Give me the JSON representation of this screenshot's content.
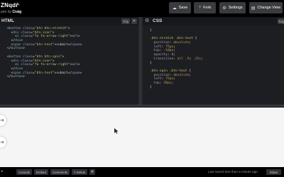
{
  "header": {
    "title": "ZNqdr",
    "author_prefix": "pen by",
    "author_name": "Craig",
    "buttons": {
      "save": "Save",
      "fork": "Fork",
      "settings": "Settings",
      "change_view": "Change View"
    }
  },
  "html_pane": {
    "title": "HTML",
    "tidy": "Tidy",
    "close": "✕",
    "lines": [
      [
        {
          "c": "t-punc",
          "t": "<"
        },
        {
          "c": "t-tag",
          "t": "button"
        },
        {
          "c": "t-txt",
          "t": " "
        },
        {
          "c": "t-attr",
          "t": "class"
        },
        {
          "c": "t-punc",
          "t": "="
        },
        {
          "c": "t-str",
          "t": "\"btn btn-stretch\""
        },
        {
          "c": "t-punc",
          "t": ">"
        }
      ],
      [
        {
          "c": "t-txt",
          "t": "  "
        },
        {
          "c": "t-punc",
          "t": "<"
        },
        {
          "c": "t-tag",
          "t": "div"
        },
        {
          "c": "t-txt",
          "t": " "
        },
        {
          "c": "t-attr",
          "t": "class"
        },
        {
          "c": "t-punc",
          "t": "="
        },
        {
          "c": "t-str",
          "t": "\"btn-icon\""
        },
        {
          "c": "t-punc",
          "t": ">"
        }
      ],
      [
        {
          "c": "t-txt",
          "t": "    "
        },
        {
          "c": "t-punc",
          "t": "<"
        },
        {
          "c": "t-tag",
          "t": "i"
        },
        {
          "c": "t-txt",
          "t": " "
        },
        {
          "c": "t-attr",
          "t": "class"
        },
        {
          "c": "t-punc",
          "t": "="
        },
        {
          "c": "t-str",
          "t": "\"fa fa-arrow-right\""
        },
        {
          "c": "t-punc",
          "t": "></"
        },
        {
          "c": "t-tag",
          "t": "i"
        },
        {
          "c": "t-punc",
          "t": ">"
        }
      ],
      [
        {
          "c": "t-txt",
          "t": "  "
        },
        {
          "c": "t-punc",
          "t": "</"
        },
        {
          "c": "t-tag",
          "t": "div"
        },
        {
          "c": "t-punc",
          "t": ">"
        }
      ],
      [
        {
          "c": "t-txt",
          "t": "  "
        },
        {
          "c": "t-punc",
          "t": "<"
        },
        {
          "c": "t-tag",
          "t": "span"
        },
        {
          "c": "t-txt",
          "t": " "
        },
        {
          "c": "t-attr",
          "t": "class"
        },
        {
          "c": "t-punc",
          "t": "="
        },
        {
          "c": "t-str",
          "t": "\"btn-text\""
        },
        {
          "c": "t-punc",
          "t": ">"
        },
        {
          "c": "t-txt",
          "t": "submit"
        },
        {
          "c": "t-punc",
          "t": "</"
        },
        {
          "c": "t-tag",
          "t": "span"
        },
        {
          "c": "t-punc",
          "t": ">"
        }
      ],
      [
        {
          "c": "t-punc",
          "t": "</"
        },
        {
          "c": "t-tag",
          "t": "button"
        },
        {
          "c": "t-punc",
          "t": ">"
        }
      ],
      [],
      [
        {
          "c": "t-punc",
          "t": "<"
        },
        {
          "c": "t-tag",
          "t": "button"
        },
        {
          "c": "t-txt",
          "t": " "
        },
        {
          "c": "t-attr",
          "t": "class"
        },
        {
          "c": "t-punc",
          "t": "="
        },
        {
          "c": "t-str",
          "t": "\"btn btn-spin\""
        },
        {
          "c": "t-punc",
          "t": ">"
        }
      ],
      [
        {
          "c": "t-txt",
          "t": "  "
        },
        {
          "c": "t-punc",
          "t": "<"
        },
        {
          "c": "t-tag",
          "t": "div"
        },
        {
          "c": "t-txt",
          "t": " "
        },
        {
          "c": "t-attr",
          "t": "class"
        },
        {
          "c": "t-punc",
          "t": "="
        },
        {
          "c": "t-str",
          "t": "\"btn-icon\""
        },
        {
          "c": "t-punc",
          "t": ">"
        }
      ],
      [
        {
          "c": "t-txt",
          "t": "    "
        },
        {
          "c": "t-punc",
          "t": "<"
        },
        {
          "c": "t-tag",
          "t": "i"
        },
        {
          "c": "t-txt",
          "t": " "
        },
        {
          "c": "t-attr",
          "t": "class"
        },
        {
          "c": "t-punc",
          "t": "="
        },
        {
          "c": "t-str",
          "t": "\"fa fa-arrow-right\""
        },
        {
          "c": "t-punc",
          "t": "></"
        },
        {
          "c": "t-tag",
          "t": "i"
        },
        {
          "c": "t-punc",
          "t": ">"
        }
      ],
      [
        {
          "c": "t-txt",
          "t": "  "
        },
        {
          "c": "t-punc",
          "t": "</"
        },
        {
          "c": "t-tag",
          "t": "div"
        },
        {
          "c": "t-punc",
          "t": ">"
        }
      ],
      [
        {
          "c": "t-txt",
          "t": "  "
        },
        {
          "c": "t-punc",
          "t": "<"
        },
        {
          "c": "t-tag",
          "t": "span"
        },
        {
          "c": "t-txt",
          "t": " "
        },
        {
          "c": "t-attr",
          "t": "class"
        },
        {
          "c": "t-punc",
          "t": "="
        },
        {
          "c": "t-str",
          "t": "\"btn-text\""
        },
        {
          "c": "t-punc",
          "t": ">"
        },
        {
          "c": "t-txt",
          "t": "submit"
        },
        {
          "c": "t-punc",
          "t": "</"
        },
        {
          "c": "t-tag",
          "t": "span"
        },
        {
          "c": "t-punc",
          "t": ">"
        }
      ],
      [
        {
          "c": "t-punc",
          "t": "</"
        },
        {
          "c": "t-tag",
          "t": "button"
        },
        {
          "c": "t-punc",
          "t": ">"
        }
      ]
    ]
  },
  "css_pane": {
    "title": "CSS",
    "tidy": "Tidy",
    "lines": [
      [
        {
          "c": "t-punc",
          "t": "}"
        }
      ],
      [],
      [
        {
          "c": "t-sel",
          "t": ".btn-stretch .btn-text"
        },
        {
          "c": "t-punc",
          "t": " {"
        }
      ],
      [
        {
          "c": "t-txt",
          "t": "  "
        },
        {
          "c": "t-prop",
          "t": "position"
        },
        {
          "c": "t-punc",
          "t": ": "
        },
        {
          "c": "t-val",
          "t": "absolute"
        },
        {
          "c": "t-punc",
          "t": ";"
        }
      ],
      [
        {
          "c": "t-txt",
          "t": "  "
        },
        {
          "c": "t-prop",
          "t": "left"
        },
        {
          "c": "t-punc",
          "t": ": "
        },
        {
          "c": "t-val",
          "t": "75px"
        },
        {
          "c": "t-punc",
          "t": ";"
        }
      ],
      [
        {
          "c": "t-txt",
          "t": "  "
        },
        {
          "c": "t-prop",
          "t": "top"
        },
        {
          "c": "t-punc",
          "t": ": "
        },
        {
          "c": "t-val",
          "t": "-10px"
        },
        {
          "c": "t-punc",
          "t": ";"
        }
      ],
      [
        {
          "c": "t-txt",
          "t": "  "
        },
        {
          "c": "t-prop",
          "t": "opacity"
        },
        {
          "c": "t-punc",
          "t": ": "
        },
        {
          "c": "t-val",
          "t": "0"
        },
        {
          "c": "t-punc",
          "t": ";"
        }
      ],
      [
        {
          "c": "t-txt",
          "t": "  "
        },
        {
          "c": "t-prop",
          "t": "transition"
        },
        {
          "c": "t-punc",
          "t": ": "
        },
        {
          "c": "t-val",
          "t": "all .5s .15s"
        },
        {
          "c": "t-punc",
          "t": ";"
        }
      ],
      [
        {
          "c": "t-punc",
          "t": "}"
        }
      ],
      [],
      [
        {
          "c": "t-sel",
          "t": ".btn-spin .btn-text"
        },
        {
          "c": "t-punc",
          "t": " {"
        }
      ],
      [
        {
          "c": "t-txt",
          "t": "  "
        },
        {
          "c": "t-prop",
          "t": "position"
        },
        {
          "c": "t-punc",
          "t": ": "
        },
        {
          "c": "t-val",
          "t": "absolute"
        },
        {
          "c": "t-punc",
          "t": ";"
        }
      ],
      [
        {
          "c": "t-txt",
          "t": "  "
        },
        {
          "c": "t-prop",
          "t": "left"
        },
        {
          "c": "t-punc",
          "t": ": "
        },
        {
          "c": "t-val",
          "t": "75px"
        },
        {
          "c": "t-punc",
          "t": ";"
        }
      ],
      [
        {
          "c": "t-txt",
          "t": "  "
        },
        {
          "c": "t-prop",
          "t": "top"
        },
        {
          "c": "t-punc",
          "t": ": "
        },
        {
          "c": "t-val",
          "t": "20px"
        },
        {
          "c": "t-punc",
          "t": ";"
        }
      ],
      [
        {
          "c": "t-punc",
          "t": "}"
        }
      ]
    ]
  },
  "preview": {
    "icons": [
      "arrow-right-icon",
      "arrow-right-icon"
    ]
  },
  "footer": {
    "console": "Console",
    "embed": "Embed",
    "comments": "Comments",
    "delete": "× Delete",
    "keys": "⌘",
    "saved_status": "Last saved less than a minute ago",
    "share": "Share"
  }
}
